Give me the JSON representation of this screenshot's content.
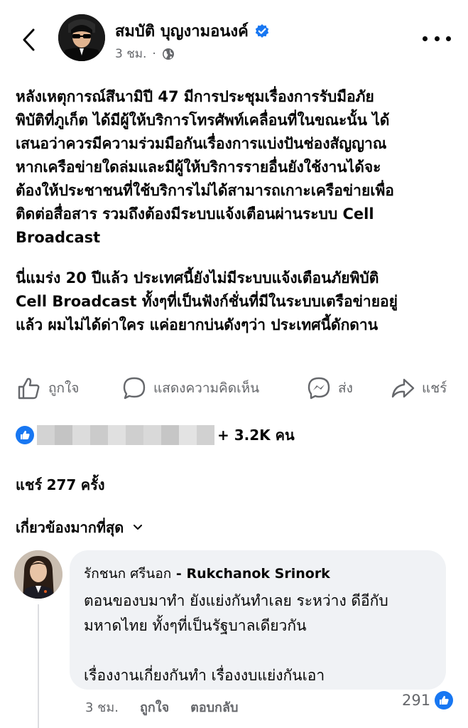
{
  "header": {
    "author_name": "สมบัติ บุญงามอนงค์",
    "time": "3 ชม.",
    "separator": "·"
  },
  "post": {
    "paragraphs": [
      "หลังเหตุการณ์สึนามิปี 47 มีการประชุมเรื่องการรับมือภัย\nพิบัติที่ภูเก็ต ได้มีผู้ให้บริการโทรศัพท์เคลื่อนที่ในขณะนั้น ได้\nเสนอว่าควรมีความร่วมมือกันเรื่องการแบ่งปันช่องสัญญาณ\nหากเครือข่ายใดล่มและมีผู้ให้บริการรายอื่นยังใช้งานได้จะ\nต้องให้ประชาชนที่ใช้บริการไม่ได้สามารถเกาะเครือข่ายเพื่อ\nติดต่อสื่อสาร รวมถึงต้องมีระบบแจ้งเตือนผ่านระบบ Cell\nBroadcast",
      "นี่แมร่ง 20 ปีแล้ว ประเทศนี้ยังไม่มีระบบแจ้งเตือนภัยพิบัติ\nCell Broadcast  ทั้งๆที่เป็นฟังก์ชั่นที่มีในระบบเตรือข่ายอยู่\nแล้ว ผมไม่ได้ด่าใคร แค่อยากบ่นดังๆว่า ประเทศนี้ดักดาน"
    ]
  },
  "actions": {
    "like": "ถูกใจ",
    "comment": "แสดงความคิดเห็น",
    "send": "ส่ง",
    "share": "แชร์"
  },
  "reactions": {
    "count": "+ 3.2K คน"
  },
  "shares": {
    "prefix": "แชร์",
    "count": "277",
    "suffix": "ครั้ง"
  },
  "comments_filter": {
    "label": "เกี่ยวข้องมากที่สุด"
  },
  "comment": {
    "author_thai": "รักชนก ศรีนอก",
    "author_dash": " - ",
    "author_en": "Rukchanok Srinork",
    "text": "ตอนของบมาทำ ยังแย่งกันทำเลย ระหว่าง ดีอีกับ\nมหาดไทย ทั้งๆที่เป็นรัฐบาลเดียวกัน\n\nเรื่องงานเกี่ยงกันทำ เรื่องงบแย่งกันเอา",
    "time": "3 ชม.",
    "like_action": "ถูกใจ",
    "reply_action": "ตอบกลับ",
    "like_count": "291"
  },
  "colors": {
    "primary_text": "#050505",
    "secondary_text": "#65676b",
    "accent_blue": "#1877f2",
    "comment_bg": "#f0f2f5"
  }
}
